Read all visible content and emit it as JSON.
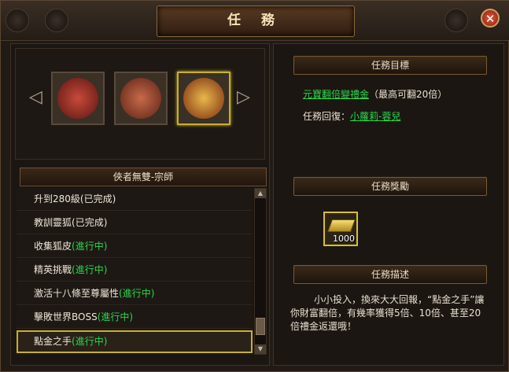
{
  "window": {
    "title": "任 務",
    "close_glyph": "✕"
  },
  "icons": {
    "left_arrow": "◁",
    "right_arrow": "▷",
    "quest_icons": [
      "warrior-portrait-icon",
      "crossed-swords-icon",
      "golden-crest-icon"
    ]
  },
  "chain": {
    "title": "俠者無雙-宗師",
    "quests": [
      {
        "name": "升到280級",
        "status": "(已完成)",
        "status_color": "#eee6d8"
      },
      {
        "name": "教訓靈狐",
        "status": "(已完成)",
        "status_color": "#eee6d8"
      },
      {
        "name": "收集狐皮",
        "status": "(進行中)",
        "status_color": "#28d84a"
      },
      {
        "name": "精英挑戰",
        "status": "(進行中)",
        "status_color": "#28d84a"
      },
      {
        "name": "激活十八條至尊屬性",
        "status": "(進行中)",
        "status_color": "#28d84a"
      },
      {
        "name": "擊敗世界BOSS",
        "status": "(進行中)",
        "status_color": "#28d84a"
      },
      {
        "name": "點金之手",
        "status": "(進行中)",
        "status_color": "#28d84a"
      }
    ]
  },
  "objective": {
    "header": "任務目標",
    "target_link": "元寶翻倍變禮金",
    "target_note": "（最高可翻20倍）",
    "return_label": "任務回復：",
    "return_link": "小蘿莉-蓉兒"
  },
  "reward": {
    "header": "任務獎勵",
    "count": "1000",
    "icon": "gold-ingot-icon"
  },
  "description": {
    "header": "任務描述",
    "text": "小小投入，換來大大回報，“點金之手”讓你財富翻倍，有幾率獲得5倍、10倍、甚至20倍禮金返還哦！"
  },
  "colors": {
    "accent_gold": "#c9b02a",
    "status_green": "#28d84a",
    "title_text": "#f4e4b8"
  }
}
